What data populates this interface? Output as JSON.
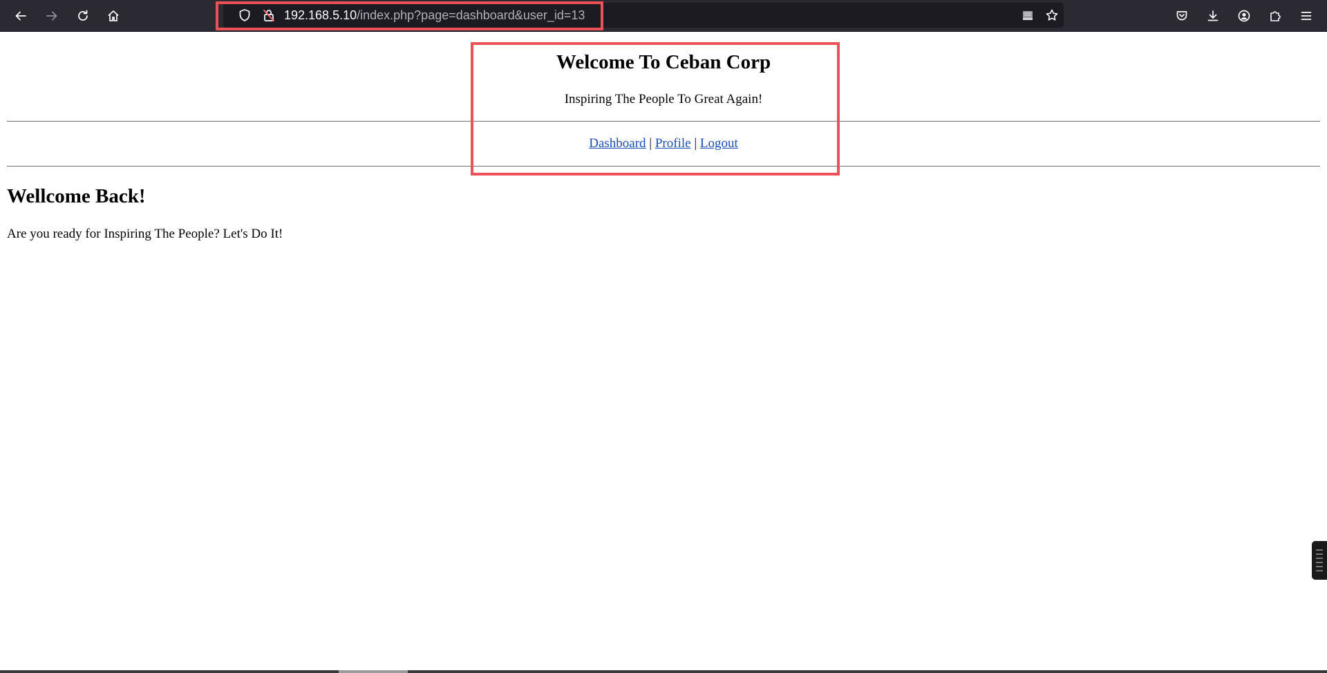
{
  "browser": {
    "url_host": "192.168.5.10",
    "url_path": "/index.php?page=dashboard&user_id=13",
    "icons": {
      "back": "back-arrow-icon",
      "forward": "forward-arrow-icon",
      "reload": "reload-icon",
      "home": "home-icon",
      "tracking_protection": "shield-icon",
      "insecure_connection": "insecure-lock-icon",
      "reader": "reader-view-icon",
      "bookmark": "star-icon",
      "pocket": "pocket-icon",
      "downloads": "download-icon",
      "account": "account-icon",
      "extensions": "extensions-icon",
      "menu": "hamburger-menu-icon"
    },
    "toolbar_color": "#2b2a33",
    "urlbar_color": "#1c1b22"
  },
  "highlight_color": "#ec5157",
  "header": {
    "title": "Welcome To Ceban Corp",
    "tagline": "Inspiring The People To Great Again!"
  },
  "nav": {
    "separator": "|",
    "links": [
      {
        "label": "Dashboard"
      },
      {
        "label": "Profile"
      },
      {
        "label": "Logout"
      }
    ],
    "link_color": "#1a4fb5"
  },
  "main": {
    "heading": "Wellcome Back!",
    "text": "Are you ready for Inspiring The People? Let's Do It!"
  }
}
